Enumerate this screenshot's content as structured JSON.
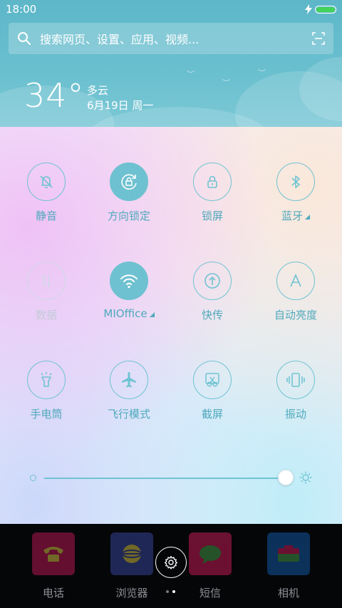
{
  "status_bar": {
    "time": "18:00"
  },
  "search": {
    "placeholder": "搜索网页、设置、应用、视频..."
  },
  "weather": {
    "temperature": "34°",
    "condition": "多云",
    "date": "6月19日 周一"
  },
  "toggles": [
    {
      "id": "mute",
      "label": "静音",
      "icon": "bell-off-icon",
      "state": "off"
    },
    {
      "id": "rotation-lock",
      "label": "方向锁定",
      "icon": "rotation-lock-icon",
      "state": "on"
    },
    {
      "id": "lock-screen",
      "label": "锁屏",
      "icon": "lock-icon",
      "state": "off"
    },
    {
      "id": "bluetooth",
      "label": "蓝牙",
      "icon": "bluetooth-icon",
      "state": "off",
      "expandable": true
    },
    {
      "id": "mobile-data",
      "label": "数据",
      "icon": "data-arrows-icon",
      "state": "disabled"
    },
    {
      "id": "wifi",
      "label": "MIOffice",
      "icon": "wifi-icon",
      "state": "on",
      "expandable": true
    },
    {
      "id": "quick-transfer",
      "label": "快传",
      "icon": "upload-icon",
      "state": "off"
    },
    {
      "id": "auto-brightness",
      "label": "自动亮度",
      "icon": "letter-a-icon",
      "state": "off"
    },
    {
      "id": "flashlight",
      "label": "手电筒",
      "icon": "flashlight-icon",
      "state": "off"
    },
    {
      "id": "airplane",
      "label": "飞行模式",
      "icon": "airplane-icon",
      "state": "off"
    },
    {
      "id": "screenshot",
      "label": "截屏",
      "icon": "scissors-icon",
      "state": "off"
    },
    {
      "id": "vibrate",
      "label": "振动",
      "icon": "vibrate-icon",
      "state": "off"
    }
  ],
  "brightness": {
    "level": 1.0
  },
  "dock": [
    {
      "label": "电话",
      "icon": "phone-app-icon",
      "color": "#d81b60"
    },
    {
      "label": "浏览器",
      "icon": "browser-app-icon",
      "color": "#1e88e5"
    },
    {
      "label": "短信",
      "icon": "sms-app-icon",
      "color": "#e91e63"
    },
    {
      "label": "相机",
      "icon": "camera-app-icon",
      "color": "#1565c0"
    }
  ],
  "colors": {
    "accent": "#6ec1d0",
    "accent_text": "#4fa9bc",
    "header_bg": "#5db7c9"
  }
}
